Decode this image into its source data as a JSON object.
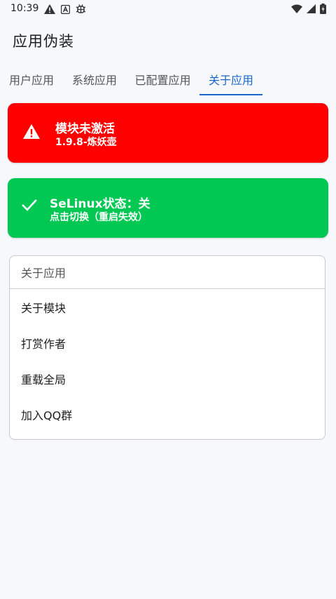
{
  "status_bar": {
    "time": "10:39"
  },
  "app": {
    "title": "应用伪装"
  },
  "tabs": [
    {
      "label": "用户应用"
    },
    {
      "label": "系统应用"
    },
    {
      "label": "已配置应用"
    },
    {
      "label": "关于应用"
    }
  ],
  "module_banner": {
    "title": "模块未激活",
    "subtitle": "1.9.8-炼妖壶",
    "icon": "warning-icon",
    "color": "#ff0000"
  },
  "selinux_banner": {
    "title": "SeLinux状态：关",
    "subtitle": "点击切换（重启失效）",
    "icon": "check-icon",
    "color": "#00c853"
  },
  "about_card": {
    "header": "关于应用",
    "items": [
      {
        "label": "关于模块"
      },
      {
        "label": "打赏作者"
      },
      {
        "label": "重载全局"
      },
      {
        "label": "加入QQ群"
      }
    ]
  },
  "colors": {
    "accent": "#1a66cc",
    "background": "#f7f8fc"
  }
}
